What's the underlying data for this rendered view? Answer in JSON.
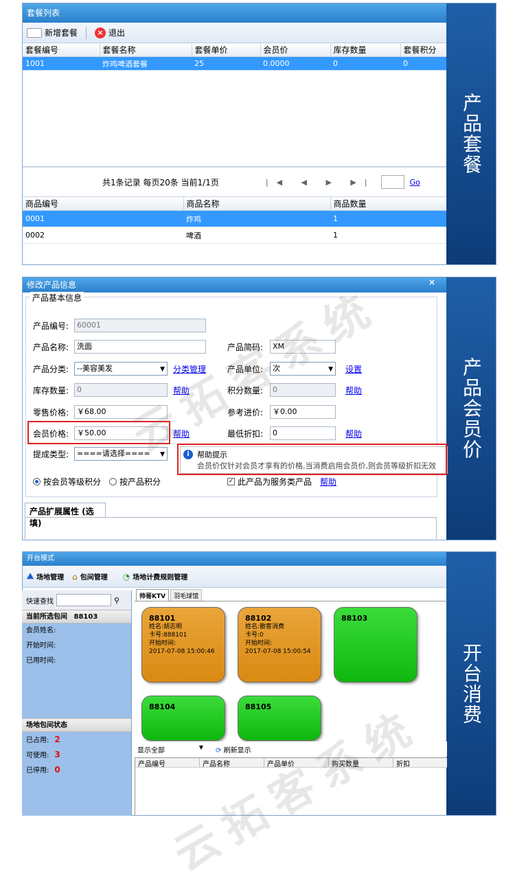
{
  "panel1": {
    "title": "套餐列表",
    "toolbar": {
      "new_label": "新增套餐",
      "exit_label": "退出"
    },
    "columns": [
      "套餐编号",
      "套餐名称",
      "套餐单价",
      "会员价",
      "库存数量",
      "套餐积分"
    ],
    "rows": [
      {
        "id": "1001",
        "name": "炸鸡啤酒套餐",
        "price": "25",
        "member_price": "0.0000",
        "stock": "0",
        "points": "0"
      }
    ],
    "pager": {
      "summary": "共1条记录 每页20条 当前1/1页",
      "nav": "|◀ ◀ ▶ ▶|",
      "go": "Go"
    },
    "sub_columns": [
      "商品编号",
      "商品名称",
      "商品数量"
    ],
    "sub_rows": [
      {
        "id": "0001",
        "name": "炸鸡",
        "qty": "1"
      },
      {
        "id": "0002",
        "name": "啤酒",
        "qty": "1"
      }
    ],
    "side_label": "产品套餐"
  },
  "panel2": {
    "title": "修改产品信息",
    "close": "×",
    "legend": "产品基本信息",
    "fields": {
      "code_label": "产品编号:",
      "code_value": "60001",
      "name_label": "产品名称:",
      "name_value": "洗面",
      "short_label": "产品简码:",
      "short_value": "XM",
      "category_label": "产品分类:",
      "category_value": "--美容美发",
      "category_link": "分类管理",
      "unit_label": "产品单位:",
      "unit_value": "次",
      "unit_link": "设置",
      "stock_label": "库存数量:",
      "stock_value": "0",
      "points_label": "积分数量:",
      "points_value": "0",
      "retail_label": "零售价格:",
      "retail_value": "￥68.00",
      "cost_label": "参考进价:",
      "cost_value": "￥0.00",
      "member_label": "会员价格:",
      "member_value": "￥50.00",
      "discount_label": "最低折扣:",
      "discount_value": "0",
      "commission_label": "提成类型:",
      "commission_value": "====请选择===="
    },
    "help_link": "帮助",
    "help_title": "帮助提示",
    "help_text": "会员价仅针对会员才享有的价格,当消费启用会员价,则会员等级折扣无效",
    "radio_a": "按会员等级积分",
    "radio_b": "按产品积分",
    "service_check": "此产品为服务类产品",
    "ext_tab": "产品扩展属性 (选填)",
    "watermark": "云拓客系统",
    "side_label": "产品会员价"
  },
  "panel3": {
    "title": "开台模式",
    "toolbar": {
      "venue": "场地管理",
      "room": "包间管理",
      "rules": "场地计费规则管理"
    },
    "search_label": "快速查找",
    "current_head": "当前所选包间",
    "current_room": "88103",
    "member_name": "会员姓名:",
    "start_time": "开始时间:",
    "used_time": "已用时间:",
    "status_head": "场地包间状态",
    "occupied_label": "已占用:",
    "occupied": "2",
    "available_label": "可使用:",
    "available": "3",
    "disabled_label": "已停用:",
    "disabled": "0",
    "tabs": [
      "帅哥KTV",
      "羽毛球馆"
    ],
    "rooms": [
      {
        "no": "88101",
        "line1": "姓名:胡志明",
        "line2": "卡号:888101",
        "line3": "开始时间:",
        "line4": "2017-07-08 15:00:46"
      },
      {
        "no": "88102",
        "line1": "姓名:散客消费",
        "line2": "卡号:0",
        "line3": "开始时间:",
        "line4": "2017-07-08 15:00:54"
      },
      {
        "no": "88103"
      },
      {
        "no": "88104"
      },
      {
        "no": "88105"
      }
    ],
    "filter": "显示全部",
    "refresh": "刷新显示",
    "columns": [
      "产品编号",
      "产品名称",
      "产品单价",
      "购买数量",
      "折扣"
    ],
    "watermark": "云拓客系统",
    "side_label": "开台消费"
  },
  "colors": {
    "titlebar": "#2b80cc",
    "side": "#0d3b78",
    "busy": "#d98a12",
    "free": "#0eb80e",
    "highlight": "#e02020"
  }
}
